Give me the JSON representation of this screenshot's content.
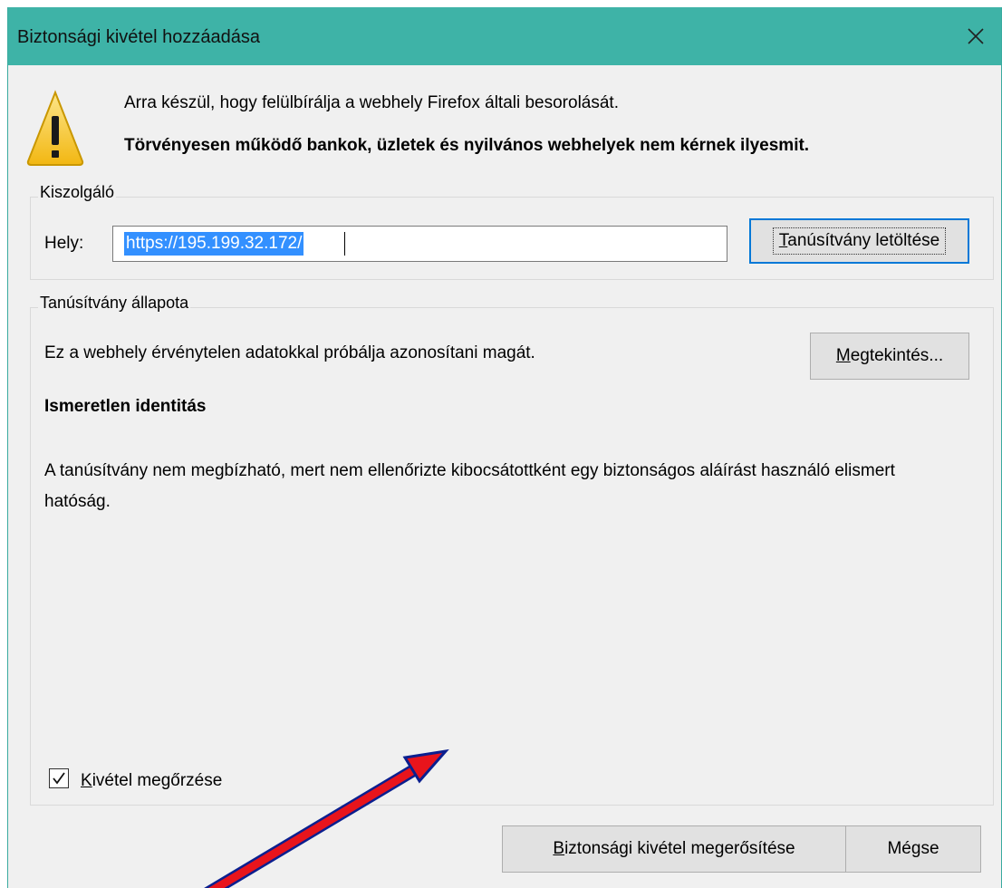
{
  "window": {
    "title": "Biztonsági kivétel hozzáadása",
    "close_icon": "close-icon"
  },
  "warning": {
    "icon": "warning-icon",
    "line1": "Arra készül, hogy felülbírálja a webhely Firefox általi besorolását.",
    "line2": "Törvényesen működő bankok, üzletek és nyilvános webhelyek nem kérnek ilyesmit."
  },
  "server": {
    "legend": "Kiszolgáló",
    "location_label": "Hely:",
    "location_value": "https://195.199.32.172/",
    "download_button": {
      "mnemonic": "T",
      "rest": "anúsítvány letöltése"
    }
  },
  "status": {
    "legend": "Tanúsítvány állapota",
    "message": "Ez a webhely érvénytelen adatokkal próbálja azonosítani magát.",
    "view_button": {
      "mnemonic": "M",
      "rest": "egtekintés..."
    },
    "identity_title": "Ismeretlen identitás",
    "identity_desc": "A tanúsítvány nem megbízható, mert nem ellenőrizte kibocsátottként egy biztonságos aláírást használó elismert hatóság."
  },
  "options": {
    "keep_exception": {
      "mnemonic": "K",
      "rest": "ivétel megőrzése",
      "checked": true
    }
  },
  "actions": {
    "confirm_button": {
      "mnemonic": "B",
      "rest": "iztonsági kivétel megerősítése"
    },
    "cancel_button": "Mégse"
  },
  "colors": {
    "titlebar": "#3eb3a7",
    "selection": "#3390ff",
    "focus_border": "#0078d7",
    "annotation_arrow": "#e8141c"
  }
}
